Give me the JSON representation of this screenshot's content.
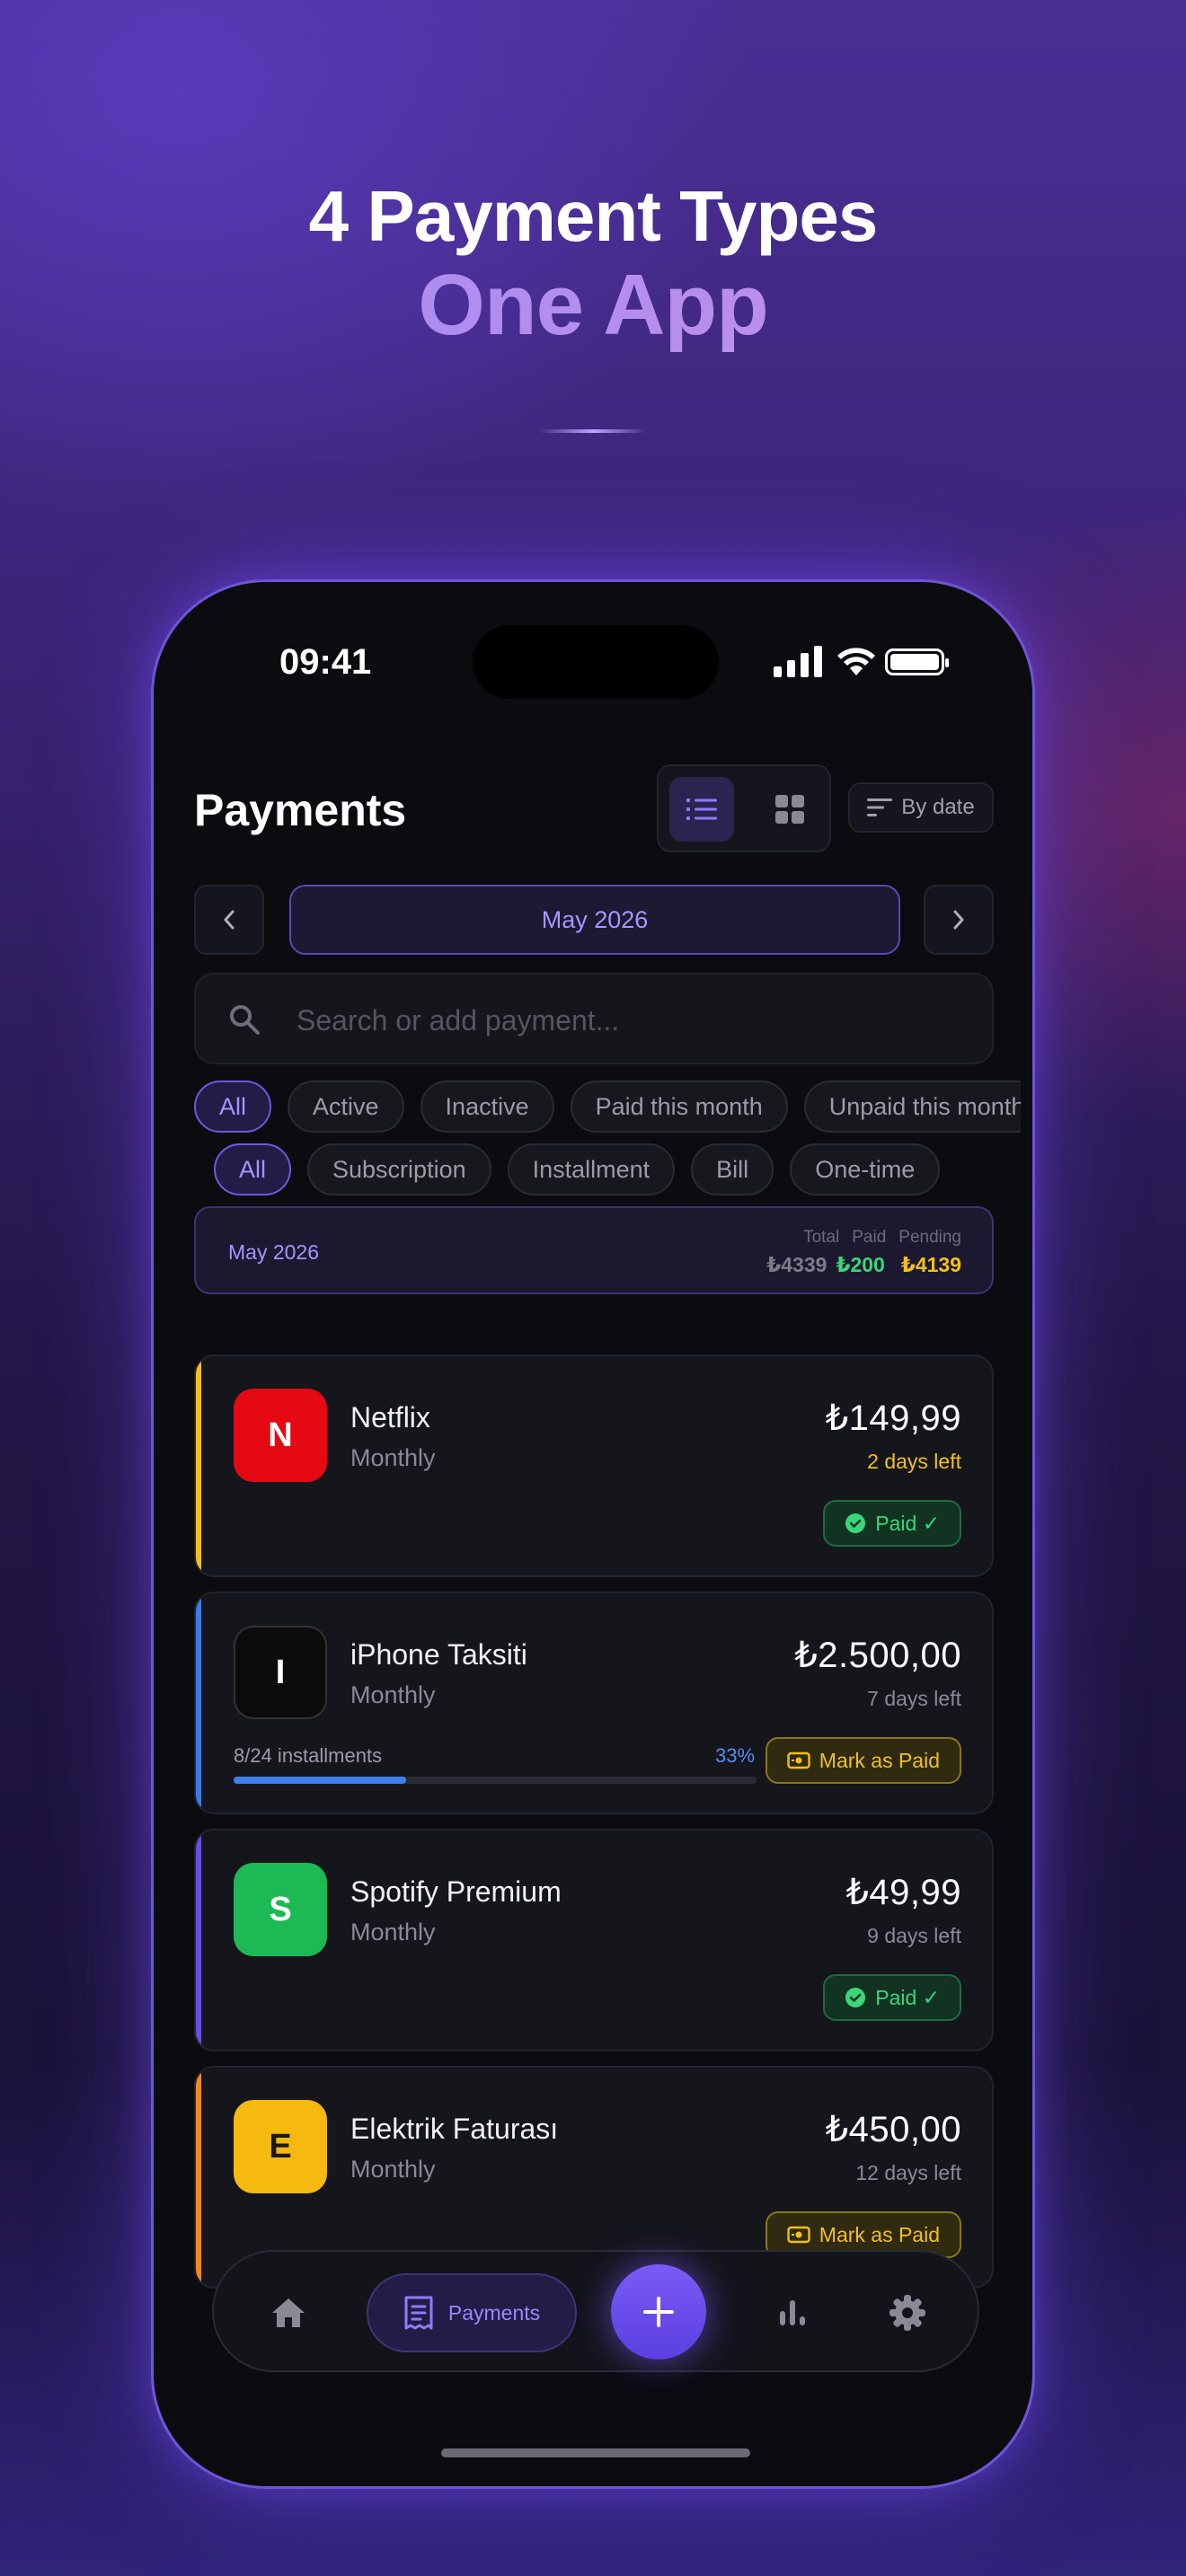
{
  "hero": {
    "title": "4 Payment Types",
    "subtitle": "One App"
  },
  "status_bar": {
    "time": "09:41"
  },
  "header": {
    "title": "Payments",
    "sort_label": "By date"
  },
  "month_nav": {
    "current": "May 2026"
  },
  "search": {
    "placeholder": "Search or add payment..."
  },
  "status_filters": [
    {
      "label": "All",
      "active": true
    },
    {
      "label": "Active",
      "active": false
    },
    {
      "label": "Inactive",
      "active": false
    },
    {
      "label": "Paid this month",
      "active": false
    },
    {
      "label": "Unpaid this month",
      "active": false
    }
  ],
  "type_filters": [
    {
      "label": "All",
      "active": true
    },
    {
      "label": "Subscription",
      "active": false
    },
    {
      "label": "Installment",
      "active": false
    },
    {
      "label": "Bill",
      "active": false
    },
    {
      "label": "One-time",
      "active": false
    }
  ],
  "summary": {
    "month": "May 2026",
    "total_label": "Total",
    "paid_label": "Paid",
    "pending_label": "Pending",
    "total": "₺4339",
    "paid": "₺200",
    "pending": "₺4139"
  },
  "payments": [
    {
      "initial": "N",
      "name": "Netflix",
      "frequency": "Monthly",
      "amount": "₺149,99",
      "due": "2 days left",
      "status": "Paid ✓",
      "status_type": "paid",
      "accent": "#f2c01a",
      "logo_bg": "#e50914",
      "logo_fg": "#ffffff",
      "due_color": "#f2c01a"
    },
    {
      "initial": "I",
      "name": "iPhone Taksiti",
      "frequency": "Monthly",
      "amount": "₺2.500,00",
      "due": "7 days left",
      "status": "Mark as Paid",
      "status_type": "mark",
      "accent": "#3d7be6",
      "logo_bg": "#0c0c0c",
      "logo_fg": "#ffffff",
      "due_color": "#8a8a96",
      "installment": {
        "label": "8/24 installments",
        "percent_label": "33%",
        "progress": 0.33
      }
    },
    {
      "initial": "S",
      "name": "Spotify Premium",
      "frequency": "Monthly",
      "amount": "₺49,99",
      "due": "9 days left",
      "status": "Paid ✓",
      "status_type": "paid",
      "accent": "#6a4fe0",
      "logo_bg": "#1db954",
      "logo_fg": "#ffffff",
      "due_color": "#8a8a96"
    },
    {
      "initial": "E",
      "name": "Elektrik Faturası",
      "frequency": "Monthly",
      "amount": "₺450,00",
      "due": "12 days left",
      "status": "Mark as Paid",
      "status_type": "mark",
      "accent": "#f08a1c",
      "logo_bg": "#f5b90f",
      "logo_fg": "#1a1a1a",
      "due_color": "#8a8a96"
    }
  ],
  "tabbar": {
    "payments_label": "Payments"
  },
  "colors": {
    "accent": "#7a5cf5",
    "paid": "#39d67a",
    "pending": "#f2c01a"
  }
}
